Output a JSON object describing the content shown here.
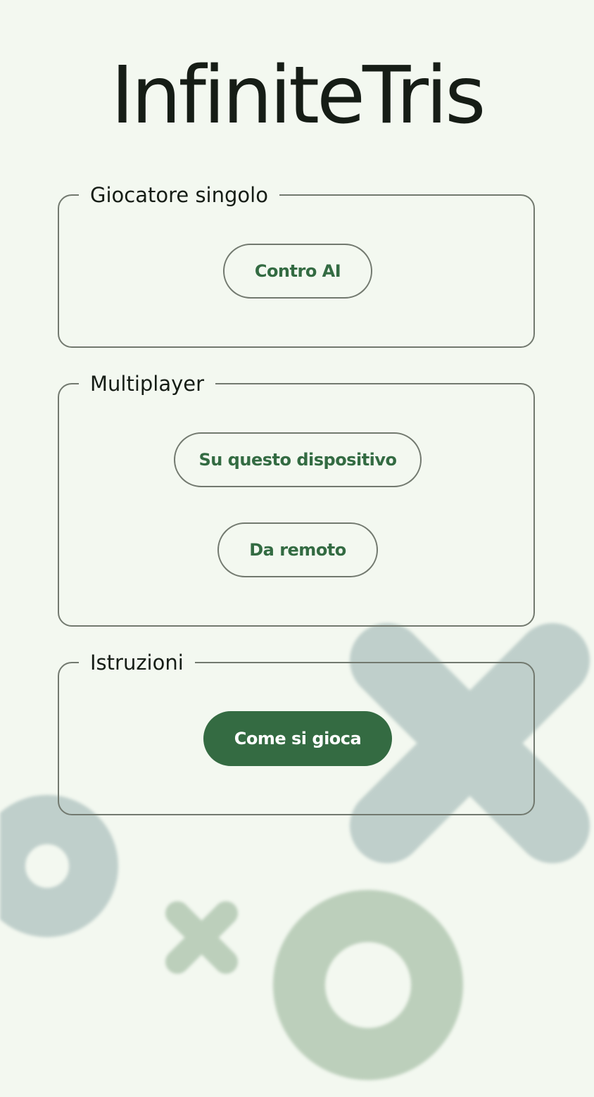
{
  "app": {
    "title": "InfiniteTris"
  },
  "sections": {
    "single": {
      "legend": "Giocatore singolo",
      "buttons": {
        "vs_ai": "Contro AI"
      }
    },
    "multi": {
      "legend": "Multiplayer",
      "buttons": {
        "local": "Su questo dispositivo",
        "remote": "Da remoto"
      }
    },
    "help": {
      "legend": "Istruzioni",
      "buttons": {
        "how_to_play": "Come si gioca"
      }
    }
  },
  "colors": {
    "background": "#f3f8f0",
    "primary": "#346b42",
    "outline": "#72796f",
    "decor_blue": "#bfcfcb",
    "decor_green": "#bccfbb"
  },
  "decor": {
    "icons": [
      "cross-icon",
      "circle-icon",
      "small-cross-icon",
      "large-circle-icon"
    ]
  }
}
